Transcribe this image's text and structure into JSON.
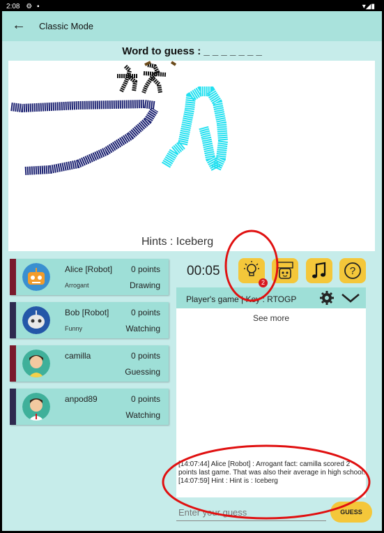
{
  "status_bar": {
    "time": "2:08"
  },
  "app_bar": {
    "title": "Classic Mode"
  },
  "word_to_guess": "Word to guess : _ _ _ _ _ _ _",
  "hints": "Hints : Iceberg",
  "players": [
    {
      "name": "Alice [Robot]",
      "points": "0 points",
      "trait": "Arrogant",
      "status": "Drawing",
      "avatar": "robot-orange"
    },
    {
      "name": "Bob [Robot]",
      "points": "0 points",
      "trait": "Funny",
      "status": "Watching",
      "avatar": "robot-blue"
    },
    {
      "name": "camilla",
      "points": "0 points",
      "trait": "",
      "status": "Guessing",
      "avatar": "girl"
    },
    {
      "name": "anpod89",
      "points": "0 points",
      "trait": "",
      "status": "Watching",
      "avatar": "boy"
    }
  ],
  "timer": "00:05",
  "hint_badge": "2",
  "toolbar_icons": [
    "lightbulb-icon",
    "robot-icon",
    "music-icon",
    "help-icon"
  ],
  "game_bar": {
    "label": "Player's game  | Key : RTOGP"
  },
  "chat": {
    "see_more": "See more",
    "messages": [
      "[14:07:44] Alice [Robot] : Arrogant fact: camilla scored 2 points last game. That was also their average in high school.",
      "[14:07:59] Hint : Hint is : Iceberg"
    ]
  },
  "guess": {
    "placeholder": "Enter your guess",
    "button": "GUESS"
  },
  "colors": {
    "accent": "#f4c73a",
    "bar": "#a9e2dc",
    "annotation": "#e01010"
  }
}
